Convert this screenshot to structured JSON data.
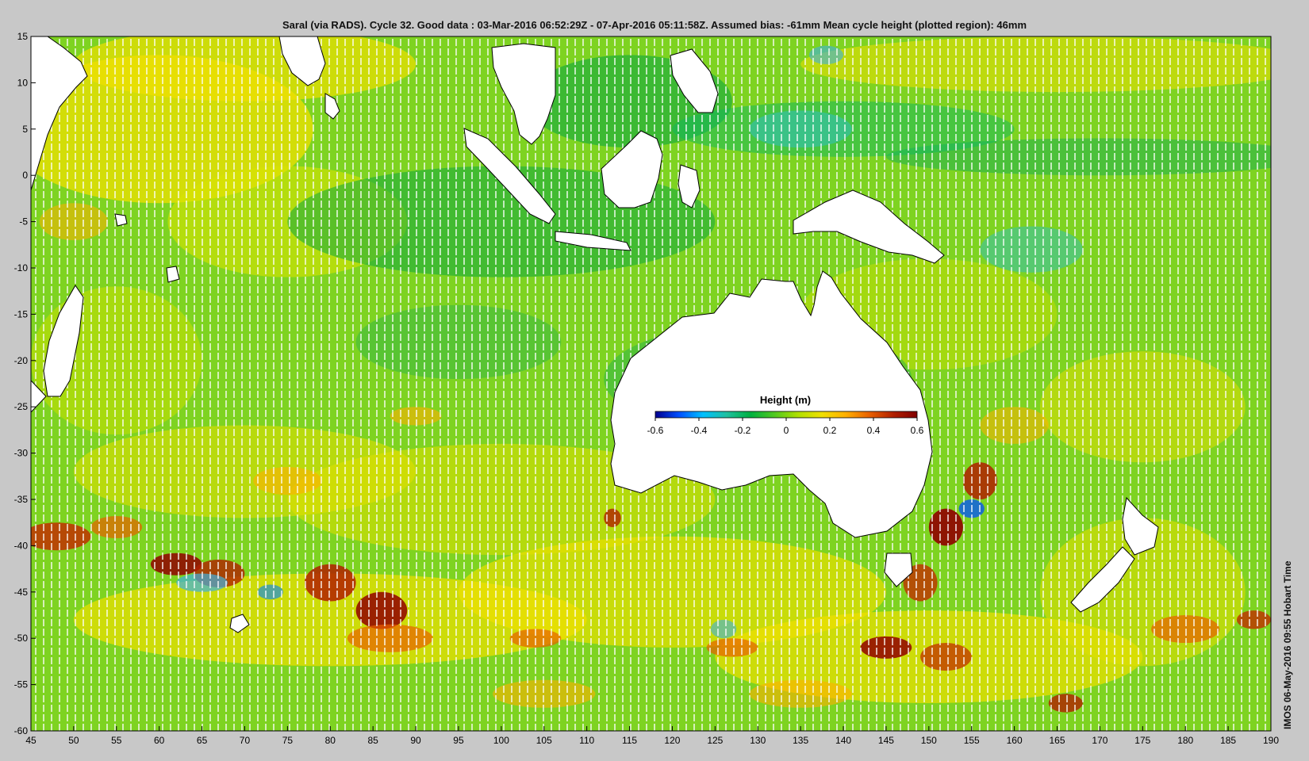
{
  "title": "Saral (via RADS). Cycle 32. Good data : 03-Mar-2016 06:52:29Z - 07-Apr-2016 05:11:58Z. Assumed bias: -61mm  Mean cycle height (plotted region): 46mm",
  "credit": "IMOS 06-May-2016 09:55 Hobart Time",
  "map": {
    "lon_range": [
      45,
      190
    ],
    "lat_range": [
      -60,
      15
    ],
    "x_ticks": [
      "45",
      "50",
      "55",
      "60",
      "65",
      "70",
      "75",
      "80",
      "85",
      "90",
      "95",
      "100",
      "105",
      "110",
      "115",
      "120",
      "125",
      "130",
      "135",
      "140",
      "145",
      "150",
      "155",
      "160",
      "165",
      "170",
      "175",
      "180",
      "185",
      "190"
    ],
    "y_ticks": [
      "15",
      "10",
      "5",
      "0",
      "-5",
      "-10",
      "-15",
      "-20",
      "-25",
      "-30",
      "-35",
      "-40",
      "-45",
      "-50",
      "-55",
      "-60"
    ],
    "colors": {
      "background": "#c8c8c8",
      "land": "#ffffff",
      "coastline": "#000000",
      "ocean_base": "#7ed321"
    }
  },
  "colorbar": {
    "title": "Height (m)",
    "ticks": [
      "-0.6",
      "-0.4",
      "-0.2",
      "0",
      "0.2",
      "0.4",
      "0.6"
    ],
    "range": [
      -0.6,
      0.6
    ],
    "colormap": [
      "#00008f",
      "#0050ff",
      "#00c0ff",
      "#20c0a0",
      "#00b040",
      "#50c820",
      "#b0e000",
      "#f0e000",
      "#ffb000",
      "#e86000",
      "#b02000",
      "#800000"
    ]
  },
  "chart_data": {
    "type": "heatmap",
    "title": "Saral (via RADS). Cycle 32. Good data : 03-Mar-2016 06:52:29Z - 07-Apr-2016 05:11:58Z. Assumed bias: -61mm  Mean cycle height (plotted region): 46mm",
    "xlim": [
      45,
      190
    ],
    "ylim": [
      -60,
      15
    ],
    "value_range": [
      -0.6,
      0.6
    ],
    "colorbar_label": "Height (m)"
  }
}
